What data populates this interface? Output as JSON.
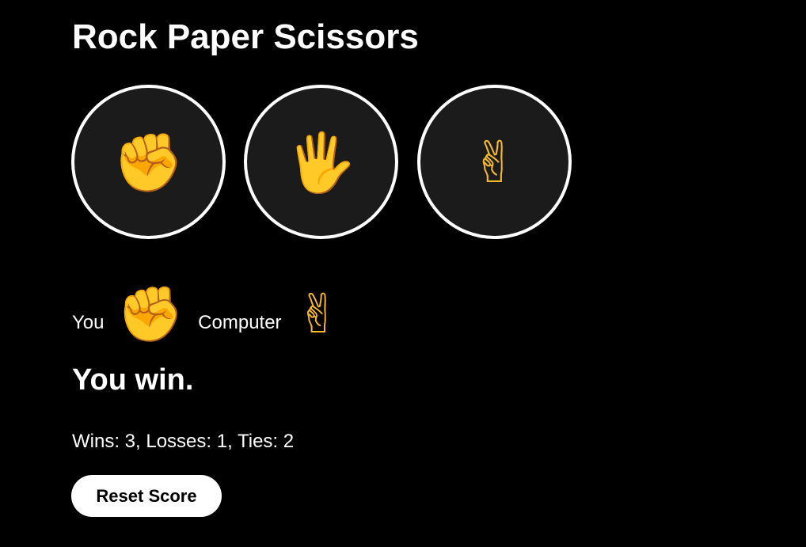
{
  "app": {
    "title": "Rock Paper Scissors"
  },
  "moves": [
    {
      "name": "rock",
      "icon": "✊",
      "icon_name": "raised-fist-icon"
    },
    {
      "name": "paper",
      "icon": "🖐",
      "icon_name": "raised-hand-icon"
    },
    {
      "name": "scissors",
      "icon": "✌",
      "icon_name": "victory-hand-icon"
    }
  ],
  "last_round": {
    "you_label": "You",
    "you_icon": "✊",
    "computer_label": "Computer",
    "computer_icon": "✌"
  },
  "result": {
    "text": "You win."
  },
  "score": {
    "text": "Wins: 3, Losses: 1, Ties: 2",
    "wins": 3,
    "losses": 1,
    "ties": 2
  },
  "controls": {
    "reset_label": "Reset Score"
  },
  "colors": {
    "background": "#000000",
    "button_fill": "#1b1b1b",
    "button_border": "#ffffff",
    "emoji_yellow": "#f7b928",
    "text": "#ffffff"
  }
}
